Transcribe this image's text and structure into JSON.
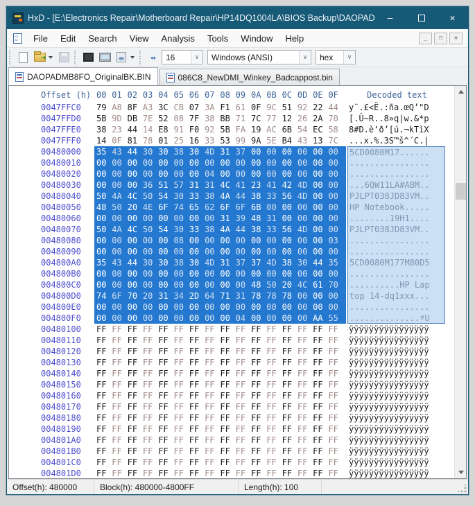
{
  "window": {
    "title": "HxD - [E:\\Electronics Repair\\Motherboard Repair\\HP14DQ1004LA\\BIOS Backup\\DAOPADMB...",
    "controls": {
      "minimize": "–",
      "maximize": "",
      "close": "✕"
    }
  },
  "menu": {
    "items": [
      "File",
      "Edit",
      "Search",
      "View",
      "Analysis",
      "Tools",
      "Window",
      "Help"
    ]
  },
  "toolbar": {
    "bytes_per_row": "16",
    "encoding": "Windows (ANSI)",
    "offset_base": "hex"
  },
  "tabs": [
    {
      "label": "DAOPADMB8FO_OriginalBK.BIN",
      "active": true
    },
    {
      "label": "086C8_NewDMI_Winkey_Badcappost.bin",
      "active": false
    }
  ],
  "hex_view": {
    "header": {
      "offset_label": "Offset (h)",
      "byte_labels": [
        "00",
        "01",
        "02",
        "03",
        "04",
        "05",
        "06",
        "07",
        "08",
        "09",
        "0A",
        "0B",
        "0C",
        "0D",
        "0E",
        "0F"
      ],
      "decoded_label": "Decoded text"
    },
    "rows": [
      {
        "offset": "0047FFC0",
        "bytes": "79 A8 8F A3 3C CB 07 3A F1 61 0F 9C 51 92 22 44",
        "text": "y¨.£<Ë.:ña.œQ’\"D",
        "selected": false
      },
      {
        "offset": "0047FFD0",
        "bytes": "5B 9D DB 7E 52 08 7F 38 BB 71 7C 77 12 26 2A 70",
        "text": "[.Û~R..8»q|w.&*p",
        "selected": false
      },
      {
        "offset": "0047FFE0",
        "bytes": "38 23 44 14 E8 91 F0 92 5B FA 19 AC 6B 54 EC 58",
        "text": "8#D.è‘ð’[ú.¬kTìX",
        "selected": false
      },
      {
        "offset": "0047FFF0",
        "bytes": "14 0F 81 78 01 25 16 33 53 99 9A 5E B4 43 13 7C",
        "text": "...x.%.3S™š^´C.|",
        "selected": false
      },
      {
        "offset": "00480000",
        "bytes": "35 43 44 30 30 38 30 4D 31 37 00 00 00 00 00 00",
        "text": "5CD0080M17......",
        "selected": true
      },
      {
        "offset": "00480010",
        "bytes": "00 00 00 00 00 00 00 00 00 00 00 00 00 00 00 00",
        "text": "................",
        "selected": true
      },
      {
        "offset": "00480020",
        "bytes": "00 00 00 00 00 00 00 04 00 00 00 00 00 00 00 00",
        "text": "................",
        "selected": true
      },
      {
        "offset": "00480030",
        "bytes": "00 00 00 36 51 57 31 31 4C 41 23 41 42 4D 00 00",
        "text": "...6QW11LA#ABM..",
        "selected": true
      },
      {
        "offset": "00480040",
        "bytes": "50 4A 4C 50 54 30 33 38 4A 44 38 33 56 4D 00 00",
        "text": "PJLPT038JD83VM..",
        "selected": true
      },
      {
        "offset": "00480050",
        "bytes": "48 50 20 4E 6F 74 65 62 6F 6F 6B 00 00 00 00 00",
        "text": "HP Notebook.....",
        "selected": true
      },
      {
        "offset": "00480060",
        "bytes": "00 00 00 00 00 00 00 00 31 39 48 31 00 00 00 00",
        "text": "........19H1....",
        "selected": true
      },
      {
        "offset": "00480070",
        "bytes": "50 4A 4C 50 54 30 33 38 4A 44 38 33 56 4D 00 00",
        "text": "PJLPT038JD83VM..",
        "selected": true
      },
      {
        "offset": "00480080",
        "bytes": "00 00 00 00 00 08 00 00 00 00 00 00 00 00 00 03",
        "text": "................",
        "selected": true
      },
      {
        "offset": "00480090",
        "bytes": "00 00 00 00 00 00 00 00 00 00 00 00 00 00 00 00",
        "text": "................",
        "selected": true
      },
      {
        "offset": "004800A0",
        "bytes": "35 43 44 30 30 38 30 4D 31 37 37 4D 38 30 44 35",
        "text": "5CD0080M177M80D5",
        "selected": true
      },
      {
        "offset": "004800B0",
        "bytes": "00 00 00 00 00 00 00 00 00 00 00 00 00 00 00 00",
        "text": "................",
        "selected": true
      },
      {
        "offset": "004800C0",
        "bytes": "00 00 00 00 00 00 00 00 00 00 48 50 20 4C 61 70",
        "text": "..........HP Lap",
        "selected": true
      },
      {
        "offset": "004800D0",
        "bytes": "74 6F 70 20 31 34 2D 64 71 31 78 78 78 00 00 00",
        "text": "top 14-dq1xxx...",
        "selected": true
      },
      {
        "offset": "004800E0",
        "bytes": "00 00 00 00 00 00 00 00 00 00 00 00 00 00 00 00",
        "text": "................",
        "selected": true
      },
      {
        "offset": "004800F0",
        "bytes": "00 00 00 00 00 00 00 00 00 04 00 00 00 00 AA 55",
        "text": "..............ªU",
        "selected": true
      },
      {
        "offset": "00480100",
        "bytes": "FF FF FF FF FF FF FF FF FF FF FF FF FF FF FF FF",
        "text": "ÿÿÿÿÿÿÿÿÿÿÿÿÿÿÿÿ",
        "selected": false
      },
      {
        "offset": "00480110",
        "bytes": "FF FF FF FF FF FF FF FF FF FF FF FF FF FF FF FF",
        "text": "ÿÿÿÿÿÿÿÿÿÿÿÿÿÿÿÿ",
        "selected": false
      },
      {
        "offset": "00480120",
        "bytes": "FF FF FF FF FF FF FF FF FF FF FF FF FF FF FF FF",
        "text": "ÿÿÿÿÿÿÿÿÿÿÿÿÿÿÿÿ",
        "selected": false
      },
      {
        "offset": "00480130",
        "bytes": "FF FF FF FF FF FF FF FF FF FF FF FF FF FF FF FF",
        "text": "ÿÿÿÿÿÿÿÿÿÿÿÿÿÿÿÿ",
        "selected": false
      },
      {
        "offset": "00480140",
        "bytes": "FF FF FF FF FF FF FF FF FF FF FF FF FF FF FF FF",
        "text": "ÿÿÿÿÿÿÿÿÿÿÿÿÿÿÿÿ",
        "selected": false
      },
      {
        "offset": "00480150",
        "bytes": "FF FF FF FF FF FF FF FF FF FF FF FF FF FF FF FF",
        "text": "ÿÿÿÿÿÿÿÿÿÿÿÿÿÿÿÿ",
        "selected": false
      },
      {
        "offset": "00480160",
        "bytes": "FF FF FF FF FF FF FF FF FF FF FF FF FF FF FF FF",
        "text": "ÿÿÿÿÿÿÿÿÿÿÿÿÿÿÿÿ",
        "selected": false
      },
      {
        "offset": "00480170",
        "bytes": "FF FF FF FF FF FF FF FF FF FF FF FF FF FF FF FF",
        "text": "ÿÿÿÿÿÿÿÿÿÿÿÿÿÿÿÿ",
        "selected": false
      },
      {
        "offset": "00480180",
        "bytes": "FF FF FF FF FF FF FF FF FF FF FF FF FF FF FF FF",
        "text": "ÿÿÿÿÿÿÿÿÿÿÿÿÿÿÿÿ",
        "selected": false
      },
      {
        "offset": "00480190",
        "bytes": "FF FF FF FF FF FF FF FF FF FF FF FF FF FF FF FF",
        "text": "ÿÿÿÿÿÿÿÿÿÿÿÿÿÿÿÿ",
        "selected": false
      },
      {
        "offset": "004801A0",
        "bytes": "FF FF FF FF FF FF FF FF FF FF FF FF FF FF FF FF",
        "text": "ÿÿÿÿÿÿÿÿÿÿÿÿÿÿÿÿ",
        "selected": false
      },
      {
        "offset": "004801B0",
        "bytes": "FF FF FF FF FF FF FF FF FF FF FF FF FF FF FF FF",
        "text": "ÿÿÿÿÿÿÿÿÿÿÿÿÿÿÿÿ",
        "selected": false
      },
      {
        "offset": "004801C0",
        "bytes": "FF FF FF FF FF FF FF FF FF FF FF FF FF FF FF FF",
        "text": "ÿÿÿÿÿÿÿÿÿÿÿÿÿÿÿÿ",
        "selected": false
      },
      {
        "offset": "004801D0",
        "bytes": "FF FF FF FF FF FF FF FF FF FF FF FF FF FF FF FF",
        "text": "ÿÿÿÿÿÿÿÿÿÿÿÿÿÿÿÿ",
        "selected": false
      }
    ]
  },
  "status_bar": {
    "offset": "Offset(h): 480000",
    "block": "Block(h): 480000-4800FF",
    "length": "Length(h): 100"
  },
  "colors": {
    "titlebar": "#175a78",
    "offset_text": "#4d4dcf",
    "header_text": "#3e6498",
    "byte_even": "#1d1d1d",
    "byte_odd": "#a18a8a",
    "selection_bg": "#2478d0",
    "decoded_selection_bg": "#cbdff5"
  }
}
